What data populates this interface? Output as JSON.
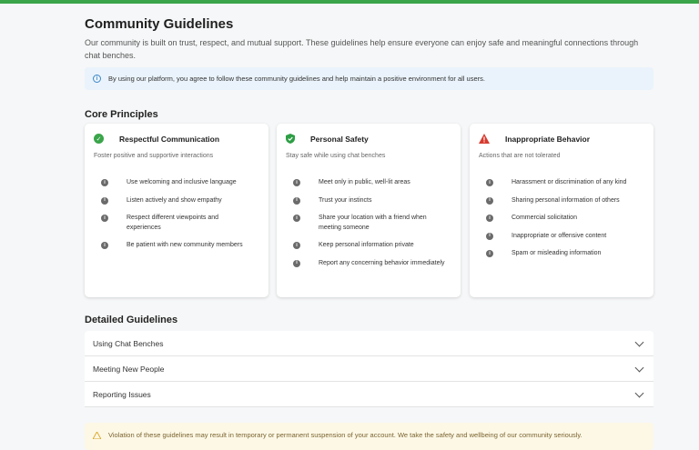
{
  "page": {
    "title": "Community Guidelines",
    "intro": "Our community is built on trust, respect, and mutual support. These guidelines help ensure everyone can enjoy safe and meaningful connections through chat benches.",
    "notice": "By using our platform, you agree to follow these community guidelines and help maintain a positive environment for all users."
  },
  "core": {
    "title": "Core Principles",
    "cards": [
      {
        "title": "Respectful Communication",
        "subtitle": "Foster positive and supportive interactions",
        "icon": "check-circle-icon",
        "items": [
          "Use welcoming and inclusive language",
          "Listen actively and show empathy",
          "Respect different viewpoints and experiences",
          "Be patient with new community members"
        ]
      },
      {
        "title": "Personal Safety",
        "subtitle": "Stay safe while using chat benches",
        "icon": "shield-check-icon",
        "items": [
          "Meet only in public, well-lit areas",
          "Trust your instincts",
          "Share your location with a friend when meeting someone",
          "Keep personal information private",
          "Report any concerning behavior immediately"
        ]
      },
      {
        "title": "Inappropriate Behavior",
        "subtitle": "Actions that are not tolerated",
        "icon": "warning-triangle-icon",
        "items": [
          "Harassment or discrimination of any kind",
          "Sharing personal information of others",
          "Commercial solicitation",
          "Inappropriate or offensive content",
          "Spam or misleading information"
        ]
      }
    ]
  },
  "detailed": {
    "title": "Detailed Guidelines",
    "items": [
      "Using Chat Benches",
      "Meeting New People",
      "Reporting Issues"
    ]
  },
  "warning": {
    "text": "Violation of these guidelines may result in temporary or permanent suspension of your account. We take the safety and wellbeing of our community seriously."
  },
  "colors": {
    "accent": "#3aa54a",
    "shield": "#2e9e45",
    "danger": "#d63b2f",
    "info": "#3b87c7",
    "notice_bg": "#eaf3fb",
    "warning_bg": "#fdf8e6"
  }
}
